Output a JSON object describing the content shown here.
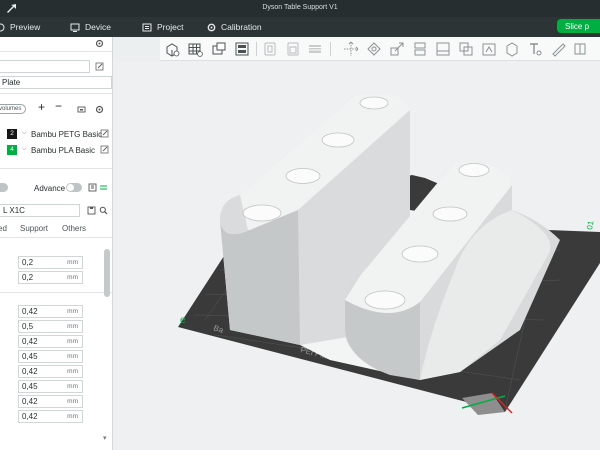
{
  "window": {
    "title": "Dyson Table Support V1"
  },
  "menu": {
    "preview": "Preview",
    "device": "Device",
    "project": "Project",
    "calibration": "Calibration",
    "slice": "Slice p"
  },
  "left_panel": {
    "plate_name": "Plate",
    "volumes_chip": "volumes",
    "filaments": [
      {
        "slot": "2",
        "name": "Bambu PETG Basic",
        "color": "#161616"
      },
      {
        "slot": "4",
        "name": "Bambu PLA Basic",
        "color": "#00ae42"
      }
    ],
    "advanced_label": "Advance",
    "printer": "L X1C",
    "tabs": [
      "ed",
      "Support",
      "Others"
    ],
    "unit": "mm",
    "values_top": [
      "0,2",
      "0,2"
    ],
    "values_bottom": [
      "0,42",
      "0,5",
      "0,42",
      "0,45",
      "0,42",
      "0,45",
      "0,42",
      "0,42"
    ]
  },
  "viewport": {
    "plate_label": "PEI Plate",
    "plate_text_left": "Ba",
    "plate_number": "01",
    "colors": {
      "bed": "#3a3a3a",
      "model": "#e6e8e9",
      "accent": "#00ae42"
    }
  }
}
